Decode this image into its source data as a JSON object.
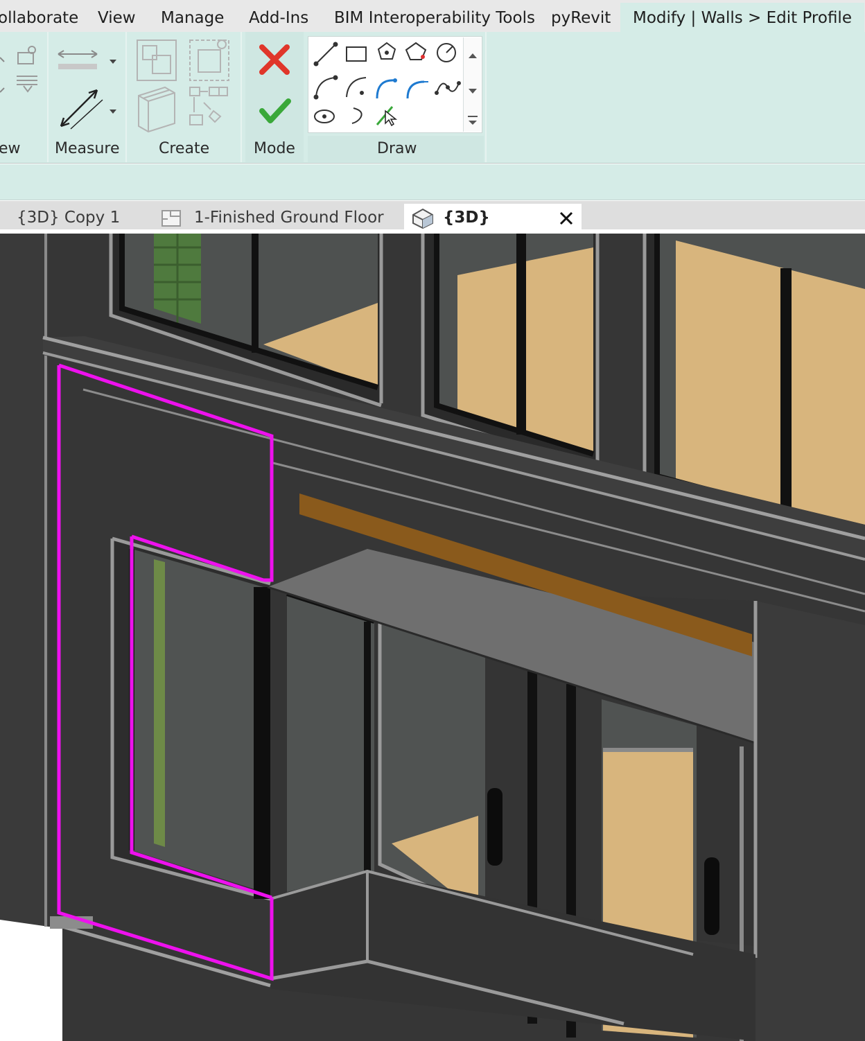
{
  "ribbon_tabs": [
    {
      "label": "ollaborate"
    },
    {
      "label": "View"
    },
    {
      "label": "Manage"
    },
    {
      "label": "Add-Ins"
    },
    {
      "label": "BIM Interoperability Tools"
    },
    {
      "label": "pyRevit"
    },
    {
      "label": "Modify | Walls > Edit Profile",
      "active": true
    }
  ],
  "panels": {
    "view": {
      "label": "ew"
    },
    "measure": {
      "label": "Measure"
    },
    "create": {
      "label": "Create"
    },
    "mode": {
      "label": "Mode"
    },
    "draw": {
      "label": "Draw"
    }
  },
  "view_tabs": [
    {
      "label": "{3D} Copy 1"
    },
    {
      "label": "1-Finished Ground Floor"
    },
    {
      "label": "{3D}",
      "active": true
    }
  ],
  "colors": {
    "ribbon_bg": "#d5ece7",
    "tabstrip_bg": "#e8e8e8",
    "sketch_line": "#ee11ee",
    "cancel_red": "#e0362a",
    "finish_green": "#3aa83a",
    "draw_blue": "#1e7ad0",
    "wall_dark": "#3a3a3a",
    "wood_floor": "#d8b57d",
    "lintel_brown": "#8a5a1c"
  },
  "icons": [
    "finish-edit-mode-icon",
    "cancel-edit-mode-icon",
    "line-icon",
    "rectangle-icon",
    "inscribed-polygon-icon",
    "circumscribed-polygon-icon",
    "circle-icon",
    "start-end-arc-icon",
    "center-end-arc-icon",
    "tangent-arc-icon",
    "fillet-arc-icon",
    "spline-icon",
    "ellipse-icon",
    "partial-ellipse-icon",
    "pick-lines-icon",
    "measure-distance-icon",
    "measure-along-element-icon"
  ]
}
